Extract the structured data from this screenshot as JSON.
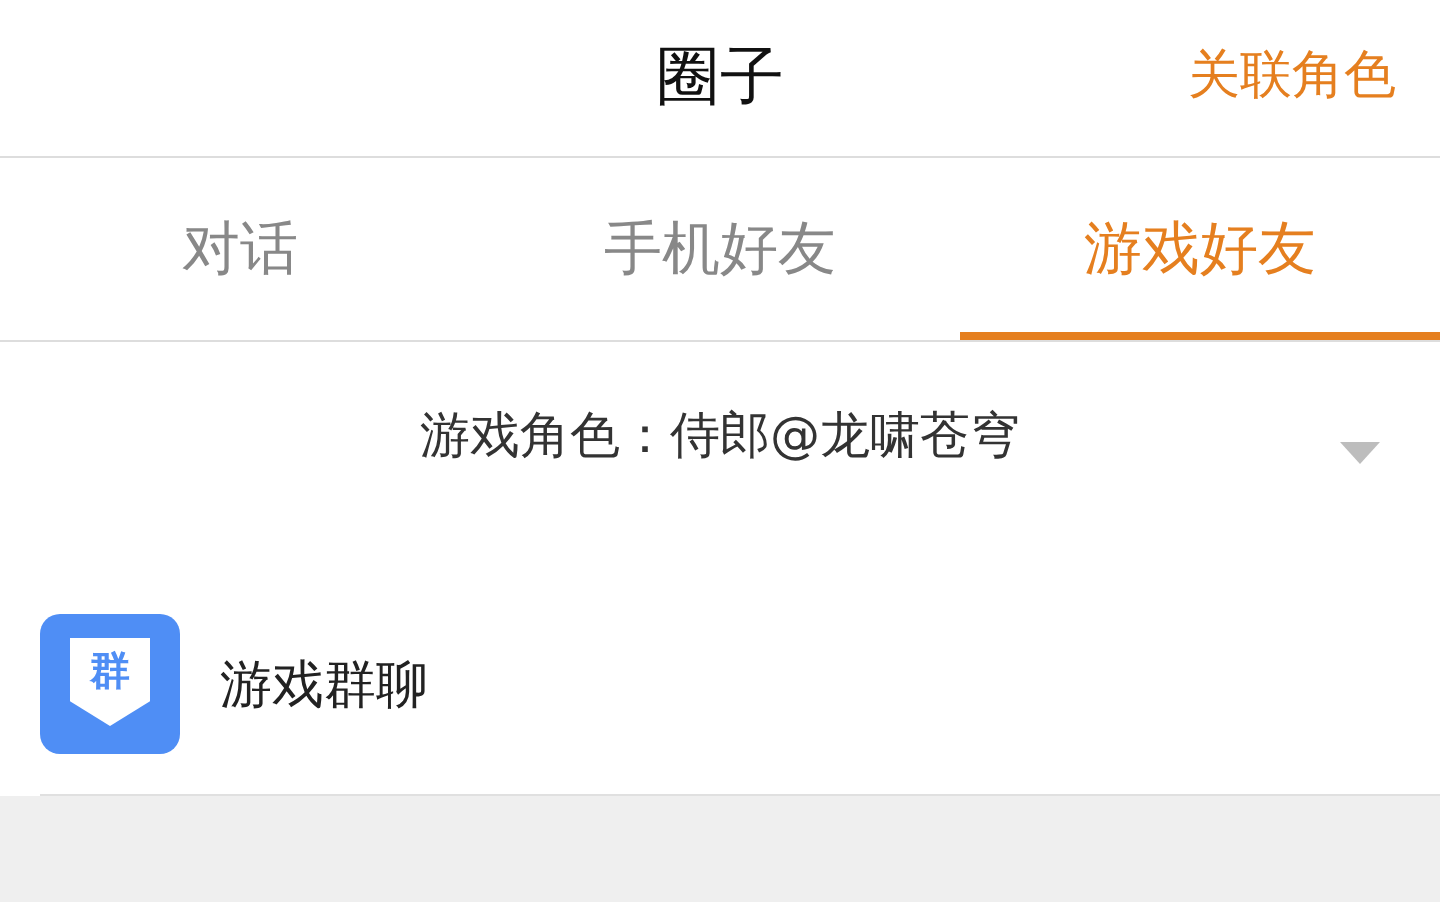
{
  "header": {
    "title": "圈子",
    "action": "关联角色"
  },
  "tabs": [
    {
      "label": "对话",
      "selected": false
    },
    {
      "label": "手机好友",
      "selected": false
    },
    {
      "label": "游戏好友",
      "selected": true
    }
  ],
  "role_selector": {
    "label": "游戏角色：侍郎@龙啸苍穹"
  },
  "items": [
    {
      "icon_label": "群",
      "title": "游戏群聊"
    }
  ]
}
